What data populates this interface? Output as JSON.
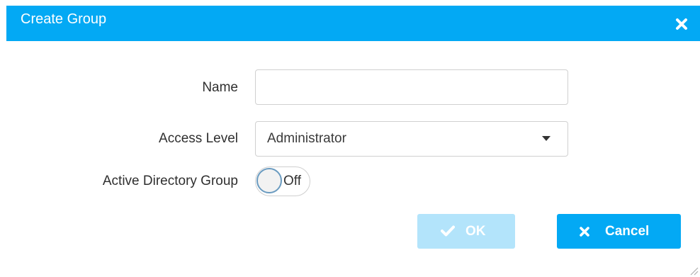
{
  "dialog": {
    "title": "Create Group",
    "header_color": "#03a9f4"
  },
  "form": {
    "name": {
      "label": "Name",
      "value": "",
      "placeholder": ""
    },
    "access_level": {
      "label": "Access Level",
      "selected": "Administrator"
    },
    "active_directory_group": {
      "label": "Active Directory Group",
      "state_text": "Off",
      "checked": false
    }
  },
  "actions": {
    "ok_label": "OK",
    "ok_enabled": false,
    "cancel_label": "Cancel"
  },
  "icons": {
    "close": "close-icon",
    "caret": "chevron-down-icon",
    "ok": "check-icon",
    "cancel": "x-icon",
    "resize": "resize-grip-icon"
  }
}
